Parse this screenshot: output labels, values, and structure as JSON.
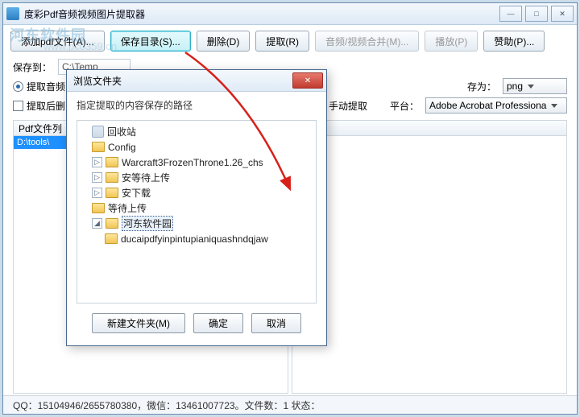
{
  "window": {
    "title": "度彩Pdf音频视频图片提取器",
    "controls": {
      "min": "—",
      "max": "□",
      "close": "✕"
    }
  },
  "toolbar": {
    "add": "添加pdf文件(A)...",
    "save_dir": "保存目录(S)...",
    "delete": "删除(D)",
    "extract": "提取(R)",
    "merge": "音频/视频合并(M)...",
    "play": "播放(P)",
    "donate": "赞助(P)..."
  },
  "save": {
    "label": "保存到：",
    "path": "C:\\Temp"
  },
  "options": {
    "opt1": "提取音频",
    "opt2": "提取后删",
    "save_as_label": "存为：",
    "save_as_value": "png",
    "manual": "手动提取",
    "platform_label": "平台：",
    "platform_value": "Adobe Acrobat Professiona"
  },
  "columns": {
    "left": "Pdf文件列"
  },
  "list": {
    "item0": "D:\\tools\\"
  },
  "status": "QQ：15104946/2655780380，微信：13461007723。文件数：1  状态：",
  "watermark": {
    "t1": "河东软件园",
    "t2": "www.pc0359.cn"
  },
  "dialog": {
    "title": "浏览文件夹",
    "subtitle": "指定提取的内容保存的路径",
    "tree": {
      "n0": "回收站",
      "n1": "Config",
      "n2": "Warcraft3FrozenThrone1.26_chs",
      "n3": "安等待上传",
      "n4": "安下载",
      "n5": "等待上传",
      "n6": "河东软件园",
      "n7": "ducaipdfyinpintupianiquashndqjaw"
    },
    "buttons": {
      "new": "新建文件夹(M)",
      "ok": "确定",
      "cancel": "取消"
    }
  }
}
